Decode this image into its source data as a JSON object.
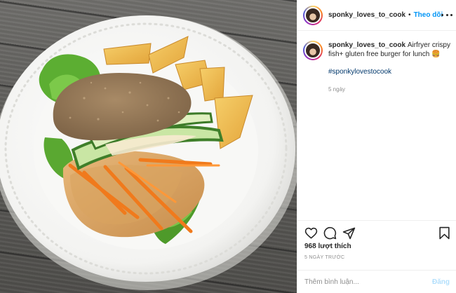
{
  "post": {
    "image_alt": "Airfryer crispy fish burger with cucumber, carrots, lettuce and potato wedges on a white plate"
  },
  "header": {
    "username": "sponky_loves_to_cook",
    "separator": "•",
    "follow_label": "Theo dõi",
    "more_icon": "more-horizontal-icon"
  },
  "caption": {
    "username": "sponky_loves_to_cook",
    "text": "Airfryer crispy fish+ gluten free burger for lunch 🍔",
    "hashtag": "#sponkylovestocook",
    "age": "5 ngày"
  },
  "actions": {
    "like_icon": "heart-icon",
    "comment_icon": "comment-icon",
    "share_icon": "send-icon",
    "save_icon": "bookmark-icon"
  },
  "stats": {
    "likes": "968 lượt thích",
    "date": "5 NGÀY TRƯỚC"
  },
  "comment": {
    "placeholder": "Thêm bình luận...",
    "post_label": "Đăng"
  },
  "colors": {
    "link_blue": "#0095f6",
    "hashtag_blue": "#00376b",
    "disabled_post": "#b2dffc",
    "muted_text": "#8e8e8e"
  }
}
